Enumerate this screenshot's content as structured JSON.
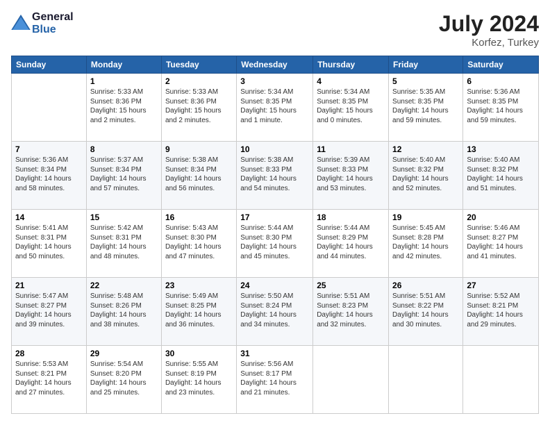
{
  "header": {
    "logo_line1": "General",
    "logo_line2": "Blue",
    "month_year": "July 2024",
    "location": "Korfez, Turkey"
  },
  "columns": [
    "Sunday",
    "Monday",
    "Tuesday",
    "Wednesday",
    "Thursday",
    "Friday",
    "Saturday"
  ],
  "weeks": [
    [
      {
        "day": "",
        "sunrise": "",
        "sunset": "",
        "daylight": ""
      },
      {
        "day": "1",
        "sunrise": "Sunrise: 5:33 AM",
        "sunset": "Sunset: 8:36 PM",
        "daylight": "Daylight: 15 hours and 2 minutes."
      },
      {
        "day": "2",
        "sunrise": "Sunrise: 5:33 AM",
        "sunset": "Sunset: 8:36 PM",
        "daylight": "Daylight: 15 hours and 2 minutes."
      },
      {
        "day": "3",
        "sunrise": "Sunrise: 5:34 AM",
        "sunset": "Sunset: 8:35 PM",
        "daylight": "Daylight: 15 hours and 1 minute."
      },
      {
        "day": "4",
        "sunrise": "Sunrise: 5:34 AM",
        "sunset": "Sunset: 8:35 PM",
        "daylight": "Daylight: 15 hours and 0 minutes."
      },
      {
        "day": "5",
        "sunrise": "Sunrise: 5:35 AM",
        "sunset": "Sunset: 8:35 PM",
        "daylight": "Daylight: 14 hours and 59 minutes."
      },
      {
        "day": "6",
        "sunrise": "Sunrise: 5:36 AM",
        "sunset": "Sunset: 8:35 PM",
        "daylight": "Daylight: 14 hours and 59 minutes."
      }
    ],
    [
      {
        "day": "7",
        "sunrise": "Sunrise: 5:36 AM",
        "sunset": "Sunset: 8:34 PM",
        "daylight": "Daylight: 14 hours and 58 minutes."
      },
      {
        "day": "8",
        "sunrise": "Sunrise: 5:37 AM",
        "sunset": "Sunset: 8:34 PM",
        "daylight": "Daylight: 14 hours and 57 minutes."
      },
      {
        "day": "9",
        "sunrise": "Sunrise: 5:38 AM",
        "sunset": "Sunset: 8:34 PM",
        "daylight": "Daylight: 14 hours and 56 minutes."
      },
      {
        "day": "10",
        "sunrise": "Sunrise: 5:38 AM",
        "sunset": "Sunset: 8:33 PM",
        "daylight": "Daylight: 14 hours and 54 minutes."
      },
      {
        "day": "11",
        "sunrise": "Sunrise: 5:39 AM",
        "sunset": "Sunset: 8:33 PM",
        "daylight": "Daylight: 14 hours and 53 minutes."
      },
      {
        "day": "12",
        "sunrise": "Sunrise: 5:40 AM",
        "sunset": "Sunset: 8:32 PM",
        "daylight": "Daylight: 14 hours and 52 minutes."
      },
      {
        "day": "13",
        "sunrise": "Sunrise: 5:40 AM",
        "sunset": "Sunset: 8:32 PM",
        "daylight": "Daylight: 14 hours and 51 minutes."
      }
    ],
    [
      {
        "day": "14",
        "sunrise": "Sunrise: 5:41 AM",
        "sunset": "Sunset: 8:31 PM",
        "daylight": "Daylight: 14 hours and 50 minutes."
      },
      {
        "day": "15",
        "sunrise": "Sunrise: 5:42 AM",
        "sunset": "Sunset: 8:31 PM",
        "daylight": "Daylight: 14 hours and 48 minutes."
      },
      {
        "day": "16",
        "sunrise": "Sunrise: 5:43 AM",
        "sunset": "Sunset: 8:30 PM",
        "daylight": "Daylight: 14 hours and 47 minutes."
      },
      {
        "day": "17",
        "sunrise": "Sunrise: 5:44 AM",
        "sunset": "Sunset: 8:30 PM",
        "daylight": "Daylight: 14 hours and 45 minutes."
      },
      {
        "day": "18",
        "sunrise": "Sunrise: 5:44 AM",
        "sunset": "Sunset: 8:29 PM",
        "daylight": "Daylight: 14 hours and 44 minutes."
      },
      {
        "day": "19",
        "sunrise": "Sunrise: 5:45 AM",
        "sunset": "Sunset: 8:28 PM",
        "daylight": "Daylight: 14 hours and 42 minutes."
      },
      {
        "day": "20",
        "sunrise": "Sunrise: 5:46 AM",
        "sunset": "Sunset: 8:27 PM",
        "daylight": "Daylight: 14 hours and 41 minutes."
      }
    ],
    [
      {
        "day": "21",
        "sunrise": "Sunrise: 5:47 AM",
        "sunset": "Sunset: 8:27 PM",
        "daylight": "Daylight: 14 hours and 39 minutes."
      },
      {
        "day": "22",
        "sunrise": "Sunrise: 5:48 AM",
        "sunset": "Sunset: 8:26 PM",
        "daylight": "Daylight: 14 hours and 38 minutes."
      },
      {
        "day": "23",
        "sunrise": "Sunrise: 5:49 AM",
        "sunset": "Sunset: 8:25 PM",
        "daylight": "Daylight: 14 hours and 36 minutes."
      },
      {
        "day": "24",
        "sunrise": "Sunrise: 5:50 AM",
        "sunset": "Sunset: 8:24 PM",
        "daylight": "Daylight: 14 hours and 34 minutes."
      },
      {
        "day": "25",
        "sunrise": "Sunrise: 5:51 AM",
        "sunset": "Sunset: 8:23 PM",
        "daylight": "Daylight: 14 hours and 32 minutes."
      },
      {
        "day": "26",
        "sunrise": "Sunrise: 5:51 AM",
        "sunset": "Sunset: 8:22 PM",
        "daylight": "Daylight: 14 hours and 30 minutes."
      },
      {
        "day": "27",
        "sunrise": "Sunrise: 5:52 AM",
        "sunset": "Sunset: 8:21 PM",
        "daylight": "Daylight: 14 hours and 29 minutes."
      }
    ],
    [
      {
        "day": "28",
        "sunrise": "Sunrise: 5:53 AM",
        "sunset": "Sunset: 8:21 PM",
        "daylight": "Daylight: 14 hours and 27 minutes."
      },
      {
        "day": "29",
        "sunrise": "Sunrise: 5:54 AM",
        "sunset": "Sunset: 8:20 PM",
        "daylight": "Daylight: 14 hours and 25 minutes."
      },
      {
        "day": "30",
        "sunrise": "Sunrise: 5:55 AM",
        "sunset": "Sunset: 8:19 PM",
        "daylight": "Daylight: 14 hours and 23 minutes."
      },
      {
        "day": "31",
        "sunrise": "Sunrise: 5:56 AM",
        "sunset": "Sunset: 8:17 PM",
        "daylight": "Daylight: 14 hours and 21 minutes."
      },
      {
        "day": "",
        "sunrise": "",
        "sunset": "",
        "daylight": ""
      },
      {
        "day": "",
        "sunrise": "",
        "sunset": "",
        "daylight": ""
      },
      {
        "day": "",
        "sunrise": "",
        "sunset": "",
        "daylight": ""
      }
    ]
  ]
}
